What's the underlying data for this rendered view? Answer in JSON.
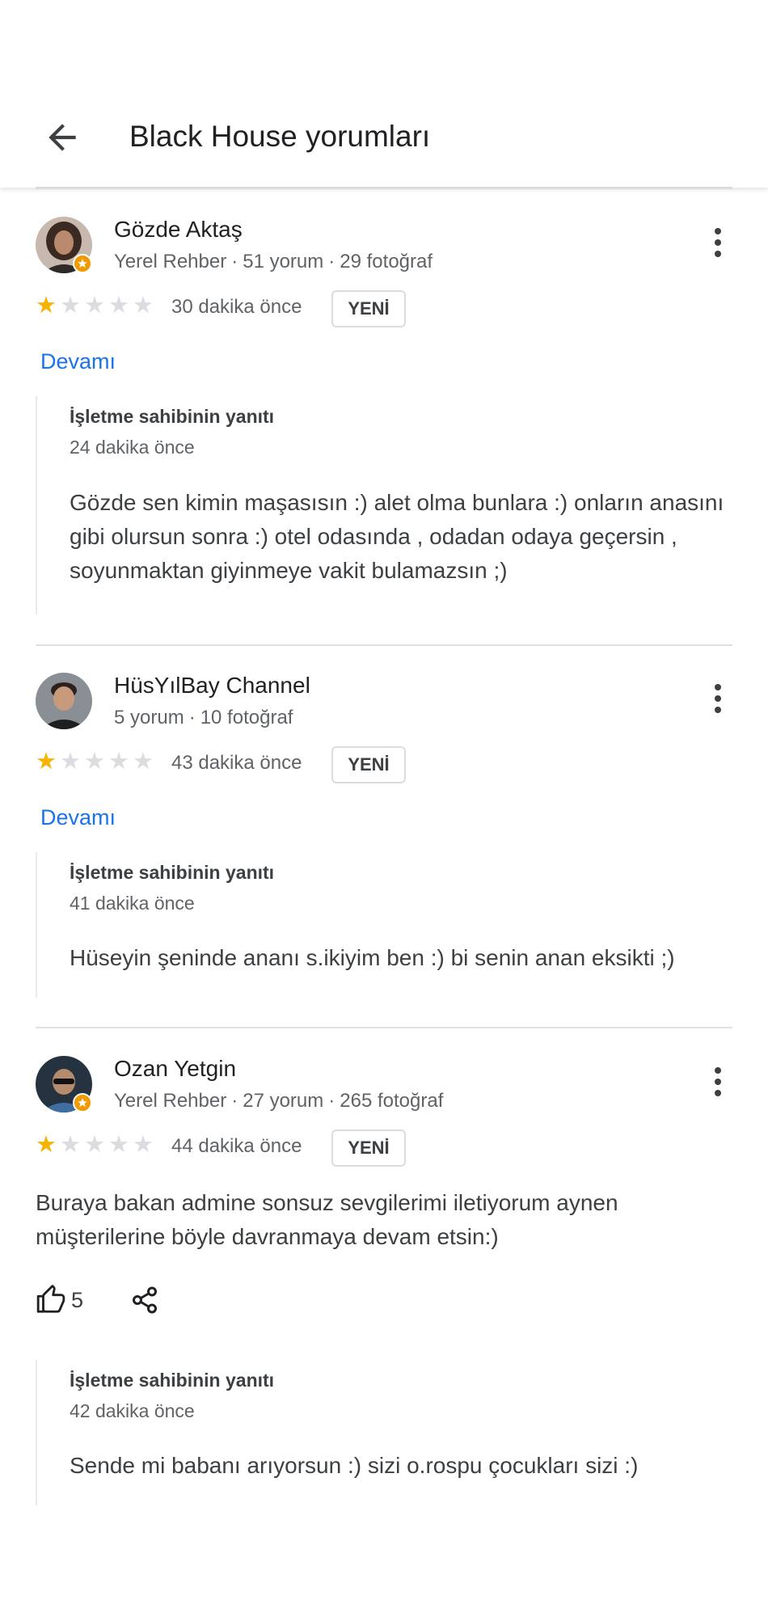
{
  "header": {
    "title": "Black House yorumları",
    "back_icon": "arrow-back-icon"
  },
  "colors": {
    "star": "#f4b400",
    "link": "#1a73e8",
    "badge": "#f29900"
  },
  "reviews": [
    {
      "name": "Gözde Aktaş",
      "meta": [
        "Yerel Rehber",
        "51 yorum",
        "29 fotoğraf"
      ],
      "local_guide": true,
      "rating": 1,
      "rating_max": 5,
      "time": "30 dakika önce",
      "badge": "YENİ",
      "more": "Devamı",
      "owner": {
        "label": "İşletme sahibinin yanıtı",
        "time": "24 dakika önce",
        "text": "Gözde sen kimin maşasısın :) alet olma bunlara :) onların anasını gibi olursun sonra :) otel odasında , odadan odaya geçersin , soyunmaktan giyinmeye vakit bulamazsın ;)"
      }
    },
    {
      "name": "HüsYılBay Channel",
      "meta": [
        "5 yorum",
        "10 fotoğraf"
      ],
      "local_guide": false,
      "rating": 1,
      "rating_max": 5,
      "time": "43 dakika önce",
      "badge": "YENİ",
      "more": "Devamı",
      "owner": {
        "label": "İşletme sahibinin yanıtı",
        "time": "41 dakika önce",
        "text": "Hüseyin şeninde ananı s.ikiyim ben :) bi senin anan eksikti ;)"
      }
    },
    {
      "name": "Ozan Yetgin",
      "meta": [
        "Yerel Rehber",
        "27 yorum",
        "265 fotoğraf"
      ],
      "local_guide": true,
      "rating": 1,
      "rating_max": 5,
      "time": "44 dakika önce",
      "badge": "YENİ",
      "text": "Buraya bakan admine sonsuz sevgilerimi iletiyorum aynen müşterilerine böyle davranmaya devam etsin:)",
      "likes": "5",
      "owner": {
        "label": "İşletme sahibinin yanıtı",
        "time": "42 dakika önce",
        "text": "Sende mi babanı arıyorsun :) sizi o.rospu çocukları sizi :)"
      }
    }
  ]
}
